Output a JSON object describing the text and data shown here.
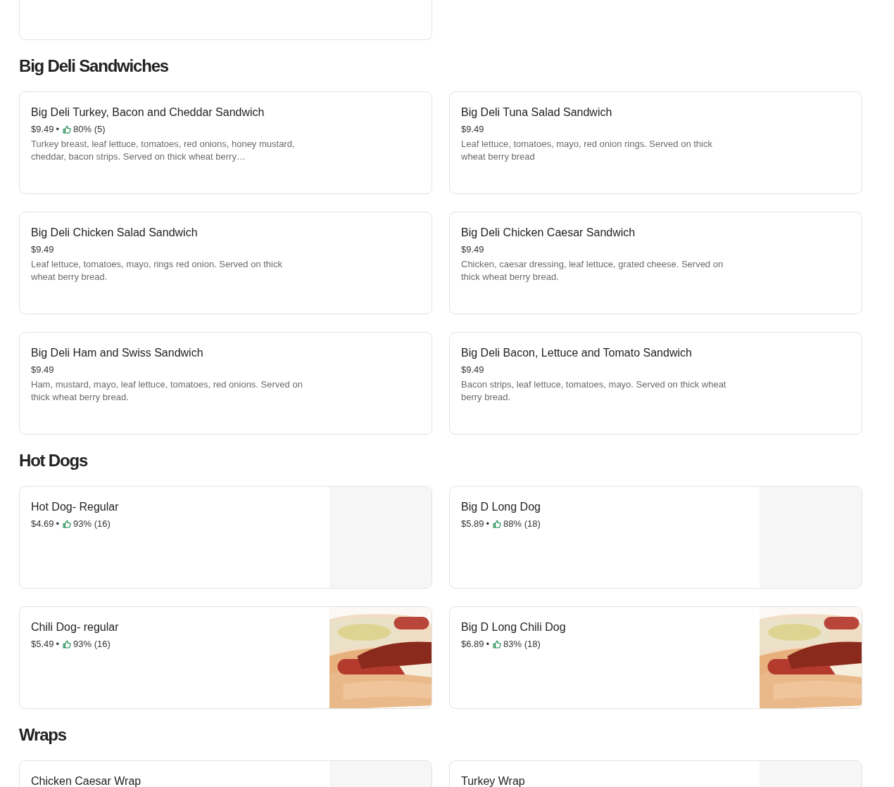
{
  "sections": [
    {
      "title": "Big Deli Sandwiches",
      "items": [
        {
          "name": "Big Deli Turkey, Bacon and Cheddar Sandwich",
          "price": "$9.49",
          "separator": "•",
          "rating": "80% (5)",
          "description": "Turkey breast, leaf lettuce, tomatoes, red onions, honey mustard, cheddar, bacon strips. Served on thick wheat berry…",
          "kind": "text"
        },
        {
          "name": "Big Deli Tuna Salad Sandwich",
          "price": "$9.49",
          "description": "Leaf lettuce, tomatoes, mayo, red onion rings. Served on thick wheat berry bread",
          "kind": "text"
        },
        {
          "name": "Big Deli Chicken Salad Sandwich",
          "price": "$9.49",
          "description": "Leaf lettuce, tomatoes, mayo, rings red onion. Served on thick wheat berry bread.",
          "kind": "text"
        },
        {
          "name": "Big Deli Chicken Caesar Sandwich",
          "price": "$9.49",
          "description": "Chicken, caesar dressing, leaf lettuce, grated cheese. Served on thick wheat berry bread.",
          "kind": "text"
        },
        {
          "name": "Big Deli Ham and Swiss Sandwich",
          "price": "$9.49",
          "description": "Ham, mustard, mayo, leaf lettuce, tomatoes, red onions. Served on thick wheat berry bread.",
          "kind": "text"
        },
        {
          "name": "Big Deli Bacon, Lettuce and Tomato Sandwich",
          "price": "$9.49",
          "description": "Bacon strips, leaf lettuce, tomatoes, mayo. Served on thick wheat berry bread.",
          "kind": "text"
        }
      ]
    },
    {
      "title": "Hot Dogs",
      "items": [
        {
          "name": "Hot Dog- Regular",
          "price": "$4.69",
          "separator": "•",
          "rating": "93% (16)",
          "kind": "placeholder"
        },
        {
          "name": "Big D Long Dog",
          "price": "$5.89",
          "separator": "•",
          "rating": "88% (18)",
          "kind": "placeholder"
        },
        {
          "name": "Chili Dog- regular",
          "price": "$5.49",
          "separator": "•",
          "rating": "93% (16)",
          "kind": "picture"
        },
        {
          "name": "Big D Long Chili Dog",
          "price": "$6.89",
          "separator": "•",
          "rating": "83% (18)",
          "kind": "picture"
        }
      ]
    },
    {
      "title": "Wraps",
      "items": [
        {
          "name": "Chicken Caesar Wrap",
          "kind": "placeholder"
        },
        {
          "name": "Turkey Wrap",
          "kind": "placeholder"
        }
      ]
    }
  ]
}
